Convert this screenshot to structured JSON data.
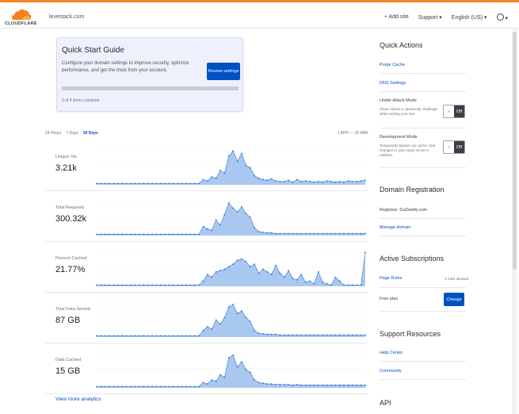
{
  "header": {
    "logo_text": "CLOUDFLARE",
    "domain": "levestack.com",
    "add_site": "+ Add site",
    "support": "Support ▾",
    "language": "English (US) ▾",
    "account_caret": "▾"
  },
  "quick_start": {
    "title": "Quick Start Guide",
    "description": "Configure your domain settings to improve security, optimize performance, and get the most from your account.",
    "button": "Review settings",
    "progress_fraction": 0,
    "count": "0 of 4 items complete"
  },
  "time_selector": {
    "tabs": [
      "24 Hours",
      "7 Days",
      "30 Days"
    ],
    "active_index": 2,
    "range": "1 APR — 30 MAY"
  },
  "metrics": [
    {
      "label": "Unique Vis",
      "value": "3.21k",
      "series": [
        2,
        2,
        2,
        2,
        2,
        2,
        2,
        2,
        2,
        2,
        2,
        2,
        2,
        2,
        2,
        2,
        2,
        2,
        2,
        2,
        2,
        2,
        2,
        2,
        2,
        8,
        6,
        12,
        10,
        22,
        18,
        44,
        52,
        36,
        48,
        30,
        26,
        14,
        10,
        8,
        7,
        9,
        6,
        5,
        5,
        7,
        4,
        8,
        5,
        6,
        5,
        4,
        5,
        4,
        6,
        5,
        4,
        5,
        4,
        6,
        5,
        5,
        6,
        7
      ]
    },
    {
      "label": "Total Requests",
      "value": "300.32k",
      "series": [
        2,
        2,
        2,
        2,
        2,
        2,
        2,
        2,
        2,
        2,
        2,
        2,
        2,
        2,
        2,
        2,
        2,
        2,
        2,
        2,
        2,
        2,
        2,
        2,
        2,
        14,
        10,
        8,
        24,
        16,
        32,
        50,
        42,
        36,
        44,
        34,
        28,
        12,
        6,
        5,
        4,
        4,
        3,
        3,
        3,
        3,
        3,
        3,
        3,
        3,
        3,
        3,
        3,
        3,
        3,
        3,
        3,
        3,
        3,
        3,
        3,
        3,
        3,
        3
      ]
    },
    {
      "label": "Percent Cached",
      "value": "21.77%",
      "series": [
        2,
        2,
        2,
        2,
        2,
        2,
        2,
        2,
        2,
        2,
        2,
        2,
        2,
        2,
        2,
        2,
        2,
        2,
        2,
        2,
        2,
        2,
        2,
        2,
        2,
        8,
        18,
        14,
        22,
        24,
        26,
        30,
        34,
        40,
        42,
        38,
        30,
        34,
        20,
        26,
        22,
        18,
        32,
        20,
        14,
        24,
        12,
        10,
        18,
        6,
        8,
        4,
        22,
        6,
        4,
        2,
        14,
        8,
        2,
        2,
        2,
        2,
        2,
        52
      ]
    },
    {
      "label": "Total Data Served",
      "value": "87 GB",
      "series": [
        2,
        2,
        2,
        2,
        2,
        2,
        2,
        2,
        2,
        2,
        2,
        2,
        2,
        2,
        2,
        2,
        2,
        2,
        2,
        2,
        2,
        2,
        2,
        2,
        2,
        10,
        16,
        12,
        26,
        20,
        30,
        46,
        50,
        36,
        40,
        30,
        24,
        10,
        6,
        5,
        4,
        4,
        4,
        3,
        3,
        3,
        3,
        3,
        3,
        3,
        3,
        3,
        3,
        3,
        3,
        3,
        3,
        3,
        3,
        3,
        3,
        3,
        3,
        3
      ]
    },
    {
      "label": "Data Cached",
      "value": "15 GB",
      "series": [
        2,
        2,
        2,
        2,
        2,
        2,
        2,
        2,
        2,
        2,
        2,
        2,
        2,
        2,
        2,
        2,
        2,
        2,
        2,
        2,
        2,
        2,
        2,
        2,
        2,
        8,
        6,
        12,
        10,
        20,
        16,
        46,
        50,
        32,
        40,
        28,
        24,
        12,
        8,
        7,
        6,
        6,
        5,
        5,
        5,
        5,
        4,
        5,
        4,
        4,
        4,
        4,
        4,
        4,
        4,
        4,
        4,
        4,
        4,
        4,
        4,
        4,
        4,
        4
      ]
    }
  ],
  "view_more": "View more analytics",
  "sidebar": {
    "quick_actions": {
      "title": "Quick Actions",
      "purge_cache": "Purge Cache",
      "dns_settings": "DNS Settings",
      "under_attack": {
        "title": "Under Attack Mode",
        "desc": "Show visitors a JavaScript challenge when visiting your site.",
        "state": "Off",
        "knob": "«"
      },
      "dev_mode": {
        "title": "Development Mode",
        "desc": "Temporarily bypass our cache. See changes to your origin server in realtime.",
        "state": "Off",
        "knob": "«"
      }
    },
    "domain_registration": {
      "title": "Domain Registration",
      "registrar": "Registrar: GoDaddy.com",
      "manage": "Manage domain"
    },
    "subscriptions": {
      "title": "Active Subscriptions",
      "page_rules": "Page Rules",
      "page_rules_note": "3 rules allowed",
      "plan": "Free plan",
      "change": "Change"
    },
    "support_resources": {
      "title": "Support Resources",
      "help": "Help Center",
      "community": "Community"
    },
    "api": {
      "title": "API"
    }
  },
  "colors": {
    "accent": "#f6821f",
    "link": "#0051c3",
    "chart_fill": "#a9c8f0",
    "chart_line": "#5a8fd6",
    "chart_dot": "#2f6fce"
  }
}
